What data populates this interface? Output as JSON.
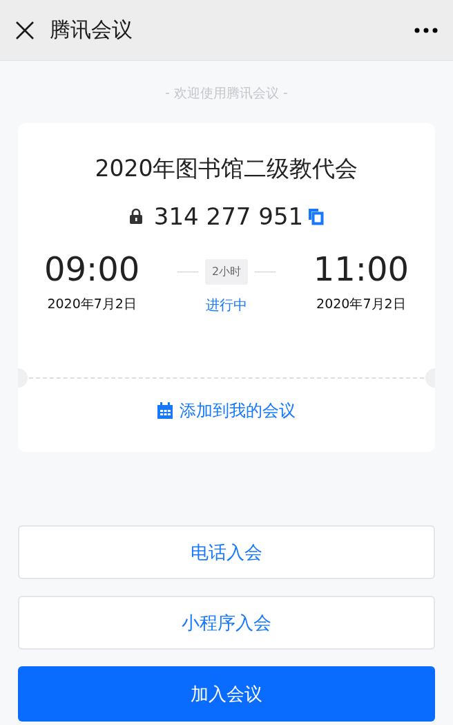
{
  "header": {
    "title": "腾讯会议"
  },
  "welcome": "- 欢迎使用腾讯会议 -",
  "meeting": {
    "title": "2020年图书馆二级教代会",
    "id": "314 277 951",
    "locked": true,
    "start": {
      "time": "09:00",
      "date": "2020年7月2日"
    },
    "end": {
      "time": "11:00",
      "date": "2020年7月2日"
    },
    "duration": "2小时",
    "status": "进行中",
    "add_link": "添加到我的会议"
  },
  "buttons": [
    {
      "label": "电话入会",
      "kind": "outline"
    },
    {
      "label": "小程序入会",
      "kind": "outline"
    },
    {
      "label": "加入会议",
      "kind": "primary"
    }
  ]
}
